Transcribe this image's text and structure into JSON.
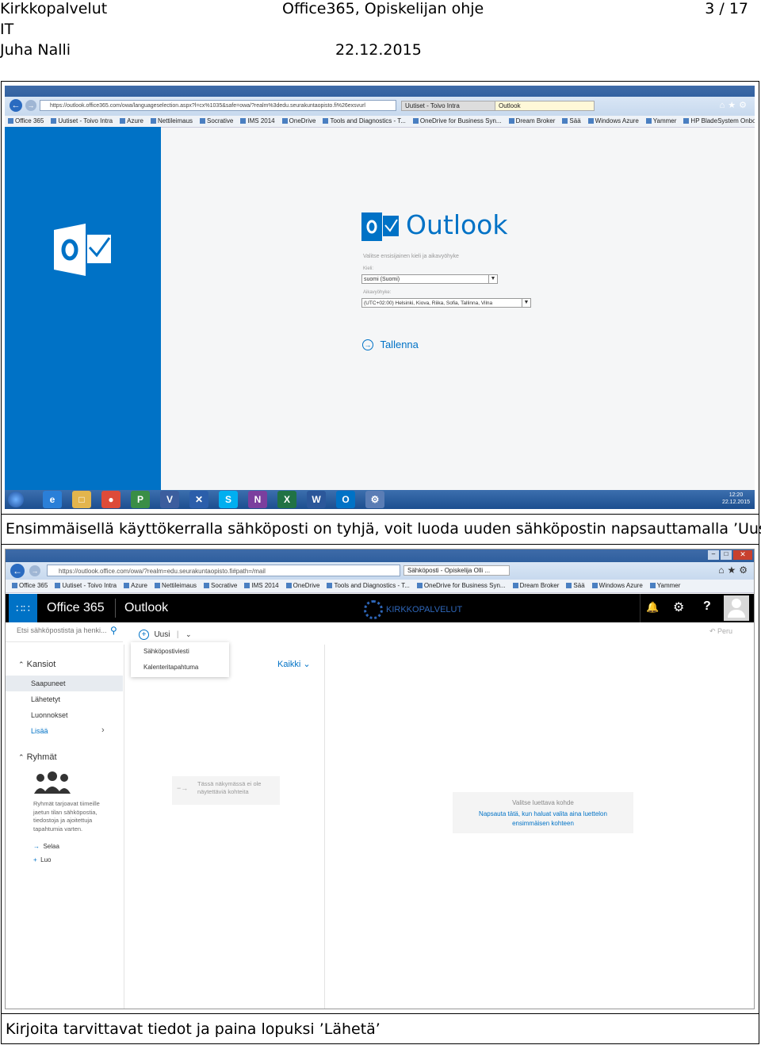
{
  "header": {
    "org": "Kirkkopalvelut",
    "unit": "IT",
    "author": "Juha Nalli",
    "doc_title": "Office365, Opiskelijan ohje",
    "date": "22.12.2015",
    "page": "3 / 17"
  },
  "shot1": {
    "address": "https://outlook.office365.com/owa/languageselection.aspx?l=cx%1035&safe=owa/?realm%3dedu.seurakuntaopisto.fi%26exsvurl",
    "tabs": [
      "Uutiset - Toivo Intra",
      "Outlook"
    ],
    "favorites": [
      "Office 365",
      "Uutiset - Toivo Intra",
      "Azure",
      "Nettileimaus",
      "Socrative",
      "IMS 2014",
      "OneDrive",
      "Tools and Diagnostics - T...",
      "OneDrive for Business Syn...",
      "Dream Broker",
      "Sää",
      "Windows Azure",
      "Yammer",
      "HP BladeSystem Onboard..."
    ],
    "brand": "Outlook",
    "intro": "Valitse ensisijainen kieli ja aikavyöhyke",
    "lang_label": "Kieli:",
    "lang_value": "suomi (Suomi)",
    "tz_label": "Aikavyöhyke:",
    "tz_value": "(UTC+02:00) Helsinki, Kiova, Riika, Sofia, Tallinna, Vilna",
    "save": "Tallenna",
    "clock_time": "12:20",
    "clock_date": "22.12.2015",
    "colors": {
      "blue": "#0072c6",
      "taskbar": "#1c4e8f"
    }
  },
  "caption1": "Ensimmäisellä käyttökerralla sähköposti on tyhjä, voit luoda uuden sähköpostin napsauttamalla ’Uusi’",
  "shot2": {
    "address": "https://outlook.office.com/owa/?realm=edu.seurakuntaopisto.fi#path=/mail",
    "tab": "Sähköposti - Opiskelija Olli ...",
    "favorites": [
      "Office 365",
      "Uutiset - Toivo Intra",
      "Azure",
      "Nettileimaus",
      "Socrative",
      "IMS 2014",
      "OneDrive",
      "Tools and Diagnostics - T...",
      "OneDrive for Business Syn...",
      "Dream Broker",
      "Sää",
      "Windows Azure",
      "Yammer"
    ],
    "suite": "Office 365",
    "app": "Outlook",
    "org_logo": "KIRKKOPALVELUT",
    "search_placeholder": "Etsi sähköpostista ja henki...",
    "new_button": "Uusi",
    "undo": "Peru",
    "menu_items": [
      "Sähköpostiviesti",
      "Kalenteritapahtuma"
    ],
    "filter": "Kaikki",
    "folders_header": "Kansiot",
    "folders": [
      "Saapuneet",
      "Lähetetyt",
      "Luonnokset",
      "Lisää"
    ],
    "groups_header": "Ryhmät",
    "groups_text": "Ryhmät tarjoavat tiimeille jaetun tilan sähköpostia, tiedostoja ja ajoitettuja tapahtumia varten.",
    "groups_actions": [
      "Selaa",
      "Luo"
    ],
    "empty_list": "Tässä näkymässä ei ole näytettäviä kohteita",
    "reading_line1": "Valitse luettava kohde",
    "reading_line2": "Napsauta tätä, kun haluat valita aina luettelon ensimmäisen kohteen"
  },
  "caption2": "Kirjoita tarvittavat tiedot ja paina lopuksi ’Lähetä’"
}
